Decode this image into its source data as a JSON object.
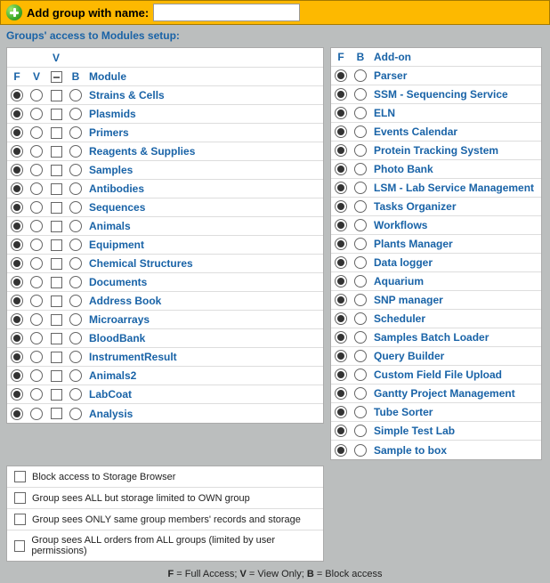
{
  "topbar": {
    "label": "Add group with name:",
    "input_value": ""
  },
  "section_title": "Groups' access to Modules setup:",
  "headers": {
    "F": "F",
    "V": "V",
    "B": "B",
    "Module": "Module",
    "Addon": "Add-on"
  },
  "modules": [
    {
      "name": "Strains & Cells",
      "f": true,
      "v": false,
      "vchk": false,
      "b": false
    },
    {
      "name": "Plasmids",
      "f": true,
      "v": false,
      "vchk": false,
      "b": false
    },
    {
      "name": "Primers",
      "f": true,
      "v": false,
      "vchk": false,
      "b": false
    },
    {
      "name": "Reagents & Supplies",
      "f": true,
      "v": false,
      "vchk": false,
      "b": false
    },
    {
      "name": "Samples",
      "f": true,
      "v": false,
      "vchk": false,
      "b": false
    },
    {
      "name": "Antibodies",
      "f": true,
      "v": false,
      "vchk": false,
      "b": false
    },
    {
      "name": "Sequences",
      "f": true,
      "v": false,
      "vchk": false,
      "b": false
    },
    {
      "name": "Animals",
      "f": true,
      "v": false,
      "vchk": false,
      "b": false
    },
    {
      "name": "Equipment",
      "f": true,
      "v": false,
      "vchk": false,
      "b": false
    },
    {
      "name": "Chemical Structures",
      "f": true,
      "v": false,
      "vchk": false,
      "b": false
    },
    {
      "name": "Documents",
      "f": true,
      "v": false,
      "vchk": false,
      "b": false
    },
    {
      "name": "Address Book",
      "f": true,
      "v": false,
      "vchk": false,
      "b": false
    },
    {
      "name": "Microarrays",
      "f": true,
      "v": false,
      "vchk": false,
      "b": false
    },
    {
      "name": "BloodBank",
      "f": true,
      "v": false,
      "vchk": false,
      "b": false
    },
    {
      "name": "InstrumentResult",
      "f": true,
      "v": false,
      "vchk": false,
      "b": false
    },
    {
      "name": "Animals2",
      "f": true,
      "v": false,
      "vchk": false,
      "b": false
    },
    {
      "name": "LabCoat",
      "f": true,
      "v": false,
      "vchk": false,
      "b": false
    },
    {
      "name": "Analysis",
      "f": true,
      "v": false,
      "vchk": false,
      "b": false
    }
  ],
  "addons": [
    {
      "name": "Parser",
      "f": true,
      "b": false
    },
    {
      "name": "SSM - Sequencing Service",
      "f": true,
      "b": false
    },
    {
      "name": "ELN",
      "f": true,
      "b": false
    },
    {
      "name": "Events Calendar",
      "f": true,
      "b": false
    },
    {
      "name": "Protein Tracking System",
      "f": true,
      "b": false
    },
    {
      "name": "Photo Bank",
      "f": true,
      "b": false
    },
    {
      "name": "LSM - Lab Service Management",
      "f": true,
      "b": false
    },
    {
      "name": "Tasks Organizer",
      "f": true,
      "b": false
    },
    {
      "name": "Workflows",
      "f": true,
      "b": false
    },
    {
      "name": "Plants Manager",
      "f": true,
      "b": false
    },
    {
      "name": "Data logger",
      "f": true,
      "b": false
    },
    {
      "name": "Aquarium",
      "f": true,
      "b": false
    },
    {
      "name": "SNP manager",
      "f": true,
      "b": false
    },
    {
      "name": "Scheduler",
      "f": true,
      "b": false
    },
    {
      "name": "Samples Batch Loader",
      "f": true,
      "b": false
    },
    {
      "name": "Query Builder",
      "f": true,
      "b": false
    },
    {
      "name": "Custom Field File Upload",
      "f": true,
      "b": false
    },
    {
      "name": "Gantty Project Management",
      "f": true,
      "b": false
    },
    {
      "name": "Tube Sorter",
      "f": true,
      "b": false
    },
    {
      "name": "Simple Test Lab",
      "f": true,
      "b": false
    },
    {
      "name": "Sample to box",
      "f": true,
      "b": false
    }
  ],
  "options": [
    {
      "label": "Block access to Storage Browser",
      "checked": false
    },
    {
      "label": "Group sees ALL but storage limited to OWN group",
      "checked": false
    },
    {
      "label": "Group sees ONLY same group members' records and storage",
      "checked": false
    },
    {
      "label": "Group sees ALL orders from ALL groups (limited by user permissions)",
      "checked": false
    }
  ],
  "legend": {
    "f_key": "F",
    "f_val": " = Full Access; ",
    "v_key": "V",
    "v_val": " = View Only; ",
    "b_key": "B",
    "b_val": " = Block access"
  }
}
